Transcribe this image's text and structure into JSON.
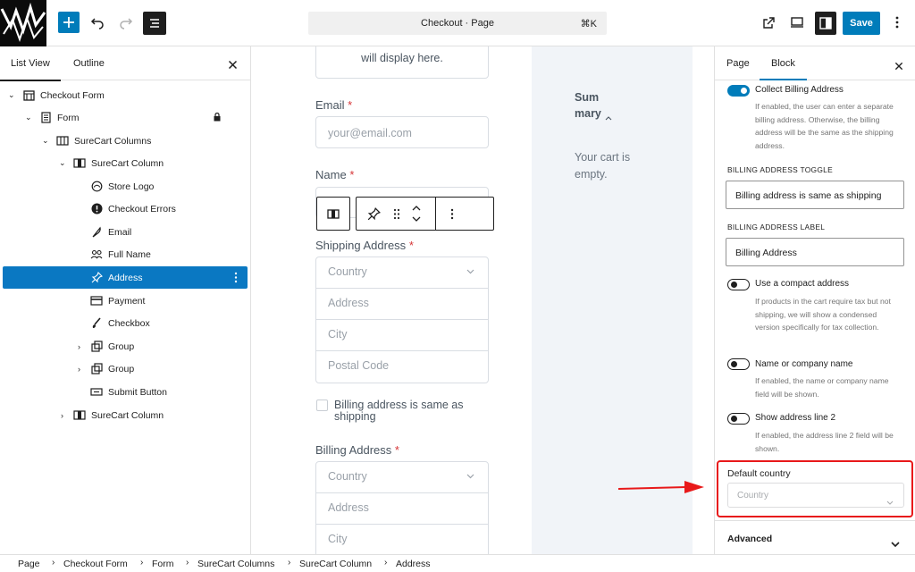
{
  "topbar": {
    "command_text": "Checkout · Page",
    "command_shortcut": "⌘K",
    "save_label": "Save"
  },
  "left_panel": {
    "tabs": [
      "List View",
      "Outline"
    ],
    "tree": [
      {
        "label": "Checkout Form",
        "icon": "store-icon"
      },
      {
        "label": "Form",
        "icon": "form-icon"
      },
      {
        "label": "SureCart Columns",
        "icon": "columns-icon"
      },
      {
        "label": "SureCart Column",
        "icon": "column-icon"
      },
      {
        "label": "Store Logo",
        "icon": "logo-icon"
      },
      {
        "label": "Checkout Errors",
        "icon": "alert-icon"
      },
      {
        "label": "Email",
        "icon": "feather-icon"
      },
      {
        "label": "Full Name",
        "icon": "people-icon"
      },
      {
        "label": "Address",
        "icon": "pin-icon"
      },
      {
        "label": "Payment",
        "icon": "payment-icon"
      },
      {
        "label": "Checkbox",
        "icon": "brush-icon"
      },
      {
        "label": "Group",
        "icon": "group-icon"
      },
      {
        "label": "Group",
        "icon": "group-icon"
      },
      {
        "label": "Submit Button",
        "icon": "button-icon"
      },
      {
        "label": "SureCart Column",
        "icon": "column-icon"
      }
    ]
  },
  "canvas": {
    "top_text": "will display here.",
    "email_label": "Email",
    "email_placeholder": "your@email.com",
    "name_label": "Name",
    "shipping_label": "Shipping Address",
    "shipping_fields": [
      "Country",
      "Address",
      "City",
      "Postal Code"
    ],
    "checkbox_label": "Billing address is same as shipping",
    "billing_label": "Billing Address",
    "billing_fields": [
      "Country",
      "Address",
      "City"
    ],
    "required_mark": "*",
    "summary_title": "Summary",
    "summary_empty": "Your cart is empty."
  },
  "right_panel": {
    "tabs": [
      "Page",
      "Block"
    ],
    "collect_billing": {
      "label": "Collect Billing Address",
      "enabled": true,
      "help": "If enabled, the user can enter a separate billing address. Otherwise, the billing address will be the same as the shipping address."
    },
    "billing_toggle_caption": "BILLING ADDRESS TOGGLE",
    "billing_toggle_value": "Billing address is same as shipping",
    "billing_label_caption": "BILLING ADDRESS LABEL",
    "billing_label_value": "Billing Address",
    "compact": {
      "label": "Use a compact address",
      "enabled": false,
      "help": "If products in the cart require tax but not shipping, we will show a condensed version specifically for tax collection."
    },
    "company": {
      "label": "Name or company name",
      "enabled": false,
      "help": "If enabled, the name or company name field will be shown."
    },
    "line2": {
      "label": "Show address line 2",
      "enabled": false,
      "help": "If enabled, the address line 2 field will be shown."
    },
    "default_country_label": "Default country",
    "default_country_placeholder": "Country",
    "advanced_label": "Advanced"
  },
  "breadcrumb": [
    "Page",
    "Checkout Form",
    "Form",
    "SureCart Columns",
    "SureCart Column",
    "Address"
  ],
  "colors": {
    "accent": "#007cba",
    "selected": "#0a78c2",
    "highlight": "#e8191a"
  }
}
